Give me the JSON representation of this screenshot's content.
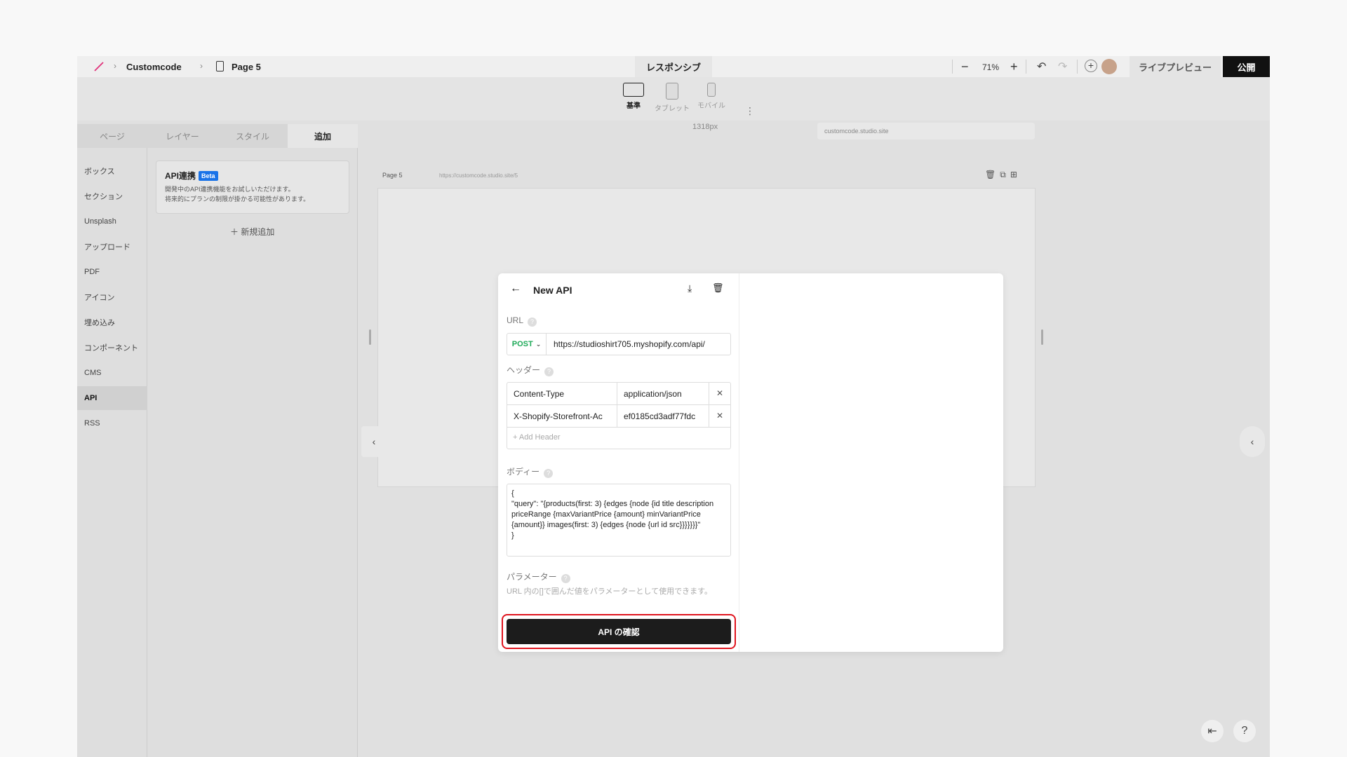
{
  "breadcrumb": {
    "project": "Customcode",
    "page": "Page 5",
    "sep": "›"
  },
  "toolbar": {
    "responsive_label": "レスポンシブ",
    "zoom": "71%",
    "zoom_minus": "−",
    "zoom_plus": "+",
    "undo": "↶",
    "redo": "↷",
    "add": "+",
    "live_preview": "ライブプレビュー",
    "publish": "公開"
  },
  "devices": [
    {
      "label": "基準",
      "active": true
    },
    {
      "label": "タブレット",
      "active": false
    },
    {
      "label": "モバイル",
      "active": false
    }
  ],
  "kebab": "⋮",
  "panel": {
    "tabs": [
      "ページ",
      "レイヤー",
      "スタイル",
      "追加"
    ],
    "active_tab": "追加",
    "categories": [
      "ボックス",
      "セクション",
      "Unsplash",
      "アップロード",
      "PDF",
      "アイコン",
      "埋め込み",
      "コンポーネント",
      "CMS",
      "API",
      "RSS"
    ],
    "active_category": "API",
    "api_card": {
      "title": "API連携",
      "badge": "Beta",
      "desc_line1": "開発中のAPI連携機能をお試しいただけます。",
      "desc_line2": "将来的にプランの制限が掛かる可能性があります。"
    },
    "add_new": "＋ 新規追加"
  },
  "canvas": {
    "ruler_label": "1318px",
    "domain": "customcode.studio.site",
    "frame_label": "Page 5",
    "frame_url": "https://customcode.studio.site/5"
  },
  "modal": {
    "title": "New API",
    "url_label": "URL",
    "method": "POST",
    "url_value": "https://studioshirt705.myshopify.com/api/",
    "headers_label": "ヘッダー",
    "headers": [
      {
        "key": "Content-Type",
        "value": "application/json"
      },
      {
        "key": "X-Shopify-Storefront-Ac",
        "value": "ef0185cd3adf77fdc"
      }
    ],
    "add_header": "+ Add Header",
    "body_label": "ボディー",
    "body_value": "{\n\"query\": \"{products(first: 3) {edges {node {id title description priceRange {maxVariantPrice {amount} minVariantPrice {amount}} images(first: 3) {edges {node {url id src}}}}}}}\"\n}",
    "params_label": "パラメーター",
    "params_help": "URL 内の[]で囲んだ値をパラメーターとして使用できます。",
    "confirm_button": "API の確認"
  },
  "colors": {
    "publish_bg": "#111111",
    "method_green": "#1faa59",
    "beta_blue": "#1a73e8",
    "highlight_red": "#e0141e"
  }
}
